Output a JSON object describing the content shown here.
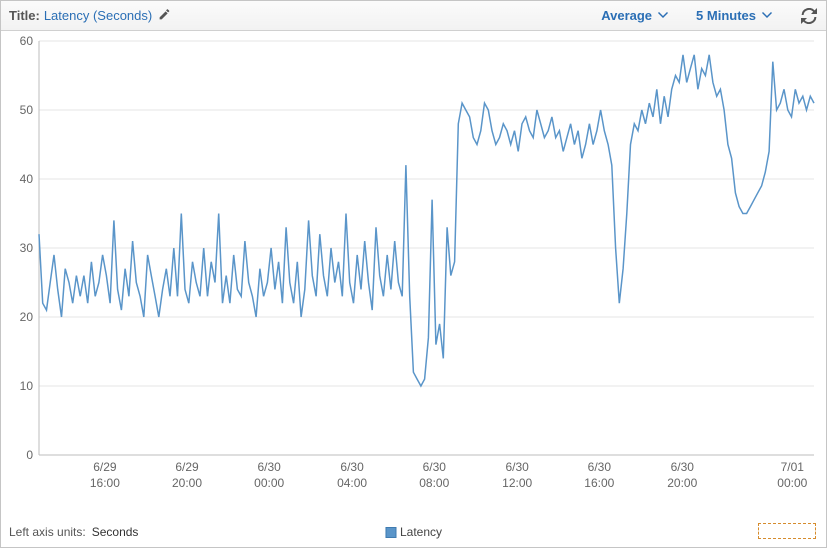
{
  "header": {
    "title_label": "Title:",
    "title_value": "Latency (Seconds)",
    "edit_icon": "pencil-icon",
    "stat_dropdown": "Average",
    "period_dropdown": "5 Minutes",
    "refresh_icon": "refresh-icon"
  },
  "footer": {
    "axis_units_label": "Left axis units:",
    "axis_units_value": "Seconds",
    "legend_label": "Latency"
  },
  "chart_data": {
    "type": "line",
    "title": "",
    "xlabel": "",
    "ylabel": "",
    "ylim": [
      0,
      60
    ],
    "y_ticks": [
      0,
      10,
      20,
      30,
      40,
      50,
      60
    ],
    "x_tick_labels": [
      "6/29\n16:00",
      "6/29\n20:00",
      "6/30\n00:00",
      "6/30\n04:00",
      "6/30\n08:00",
      "6/30\n12:00",
      "6/30\n16:00",
      "6/30\n20:00",
      "7/01\n00:00"
    ],
    "x_tick_positions": [
      0.085,
      0.191,
      0.297,
      0.404,
      0.51,
      0.617,
      0.723,
      0.83,
      0.972
    ],
    "legend": [
      "Latency"
    ],
    "series": [
      {
        "name": "Latency",
        "color": "#5a95c9",
        "x": [
          0,
          1,
          2,
          3,
          4,
          5,
          6,
          7,
          8,
          9,
          10,
          11,
          12,
          13,
          14,
          15,
          16,
          17,
          18,
          19,
          20,
          21,
          22,
          23,
          24,
          25,
          26,
          27,
          28,
          29,
          30,
          31,
          32,
          33,
          34,
          35,
          36,
          37,
          38,
          39,
          40,
          41,
          42,
          43,
          44,
          45,
          46,
          47,
          48,
          49,
          50,
          51,
          52,
          53,
          54,
          55,
          56,
          57,
          58,
          59,
          60,
          61,
          62,
          63,
          64,
          65,
          66,
          67,
          68,
          69,
          70,
          71,
          72,
          73,
          74,
          75,
          76,
          77,
          78,
          79,
          80,
          81,
          82,
          83,
          84,
          85,
          86,
          87,
          88,
          89,
          90,
          91,
          92,
          93,
          94,
          95,
          96,
          97,
          98,
          99,
          100,
          101,
          102,
          103,
          104,
          105,
          106,
          107,
          108,
          109,
          110,
          111,
          112,
          113,
          114,
          115,
          116,
          117,
          118,
          119,
          120,
          121,
          122,
          123,
          124,
          125,
          126,
          127,
          128,
          129,
          130,
          131,
          132,
          133,
          134,
          135,
          136,
          137,
          138,
          139,
          140,
          141,
          142,
          143,
          144,
          145,
          146,
          147,
          148,
          149,
          150,
          151,
          152,
          153,
          154,
          155,
          156,
          157,
          158,
          159,
          160,
          161,
          162,
          163,
          164,
          165,
          166,
          167,
          168,
          169,
          170,
          171,
          172,
          173,
          174,
          175,
          176,
          177,
          178,
          179,
          180,
          181,
          182,
          183,
          184,
          185,
          186,
          187,
          188,
          189,
          190,
          191,
          192,
          193,
          194,
          195,
          196,
          197,
          198,
          199,
          200,
          201,
          202,
          203,
          204,
          205,
          206,
          207
        ],
        "values": [
          32,
          22,
          21,
          25,
          29,
          24,
          20,
          27,
          25,
          22,
          26,
          23,
          26,
          22,
          28,
          23,
          25,
          29,
          26,
          22,
          34,
          24,
          21,
          27,
          23,
          31,
          25,
          23,
          20,
          29,
          26,
          23,
          20,
          24,
          27,
          23,
          30,
          23,
          35,
          24,
          22,
          28,
          25,
          23,
          30,
          23,
          28,
          25,
          35,
          22,
          26,
          22,
          29,
          24,
          23,
          31,
          25,
          23,
          20,
          27,
          23,
          25,
          30,
          24,
          28,
          22,
          33,
          25,
          22,
          28,
          20,
          24,
          34,
          26,
          23,
          32,
          26,
          23,
          30,
          25,
          28,
          23,
          35,
          25,
          22,
          29,
          24,
          31,
          25,
          21,
          33,
          26,
          23,
          29,
          24,
          31,
          25,
          23,
          42,
          23,
          12,
          11,
          10,
          11,
          17,
          37,
          16,
          19,
          14,
          33,
          26,
          28,
          48,
          51,
          50,
          49,
          46,
          45,
          47,
          51,
          50,
          47,
          45,
          46,
          48,
          47,
          45,
          47,
          44,
          48,
          49,
          47,
          46,
          50,
          48,
          46,
          47,
          49,
          46,
          47,
          44,
          46,
          48,
          45,
          47,
          43,
          45,
          48,
          45,
          47,
          50,
          47,
          45,
          42,
          30,
          22,
          27,
          35,
          45,
          48,
          47,
          50,
          48,
          51,
          49,
          53,
          48,
          52,
          49,
          53,
          55,
          54,
          58,
          54,
          56,
          58,
          53,
          56,
          55,
          58,
          54,
          52,
          53,
          50,
          45,
          43,
          38,
          36,
          35,
          35,
          36,
          37,
          38,
          39,
          41,
          44,
          57,
          50,
          51,
          53,
          50,
          49,
          53,
          51,
          52,
          50,
          52,
          51
        ]
      }
    ]
  }
}
